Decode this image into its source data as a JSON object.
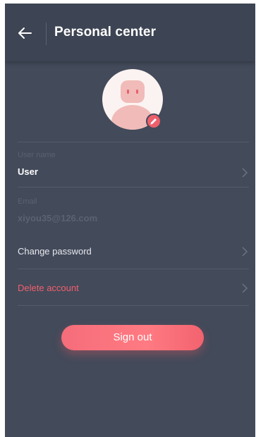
{
  "header": {
    "title": "Personal center",
    "back_icon": "arrow-left-icon"
  },
  "profile": {
    "avatar_icon": "avatar-face-icon",
    "edit_icon": "pencil-icon",
    "user_name": {
      "label": "User name",
      "value": "User"
    },
    "email": {
      "label": "Email",
      "value": "xiyou35@126.com"
    }
  },
  "actions": {
    "change_password": "Change password",
    "delete_account": "Delete account",
    "sign_out": "Sign out"
  },
  "colors": {
    "background": "#434a5a",
    "header": "#3d4453",
    "accent": "#f26876",
    "danger_text": "#f0606e",
    "muted_text": "#5a6273"
  }
}
